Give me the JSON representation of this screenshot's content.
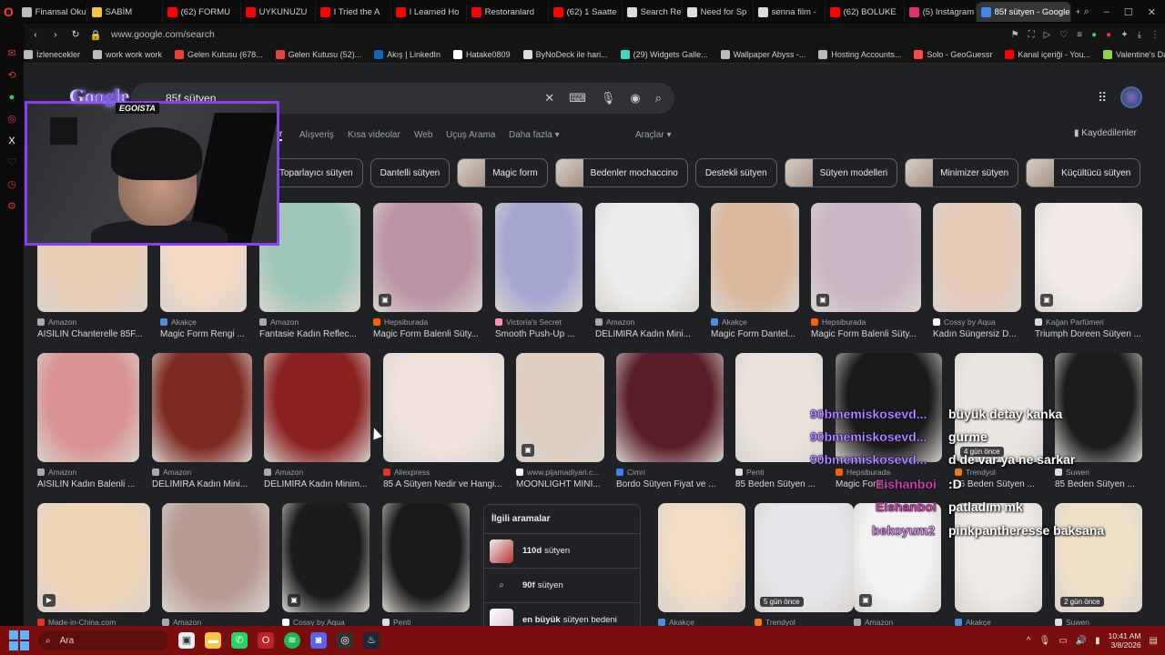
{
  "browser": {
    "tabs": [
      {
        "label": "Finansal Oku",
        "color": "#bbbbbb"
      },
      {
        "label": "SABİM",
        "color": "#f4c542"
      },
      {
        "label": "(62) FORMU",
        "color": "#ff0000"
      },
      {
        "label": "UYKUNUZU",
        "color": "#ff0000"
      },
      {
        "label": "I Tried the A",
        "color": "#ff0000"
      },
      {
        "label": "I Learned Ho",
        "color": "#ff0000"
      },
      {
        "label": "Restoranlard",
        "color": "#ff0000"
      },
      {
        "label": "(62) 1 Saatte",
        "color": "#ff0000"
      },
      {
        "label": "Search Resu",
        "color": "#dddddd"
      },
      {
        "label": "Need for Sp",
        "color": "#dddddd"
      },
      {
        "label": "senna film -",
        "color": "#dddddd"
      },
      {
        "label": "(62) BOLUKE",
        "color": "#ff0000"
      },
      {
        "label": "(5) Instagram",
        "color": "#e1306c"
      },
      {
        "label": "85f sütyen - Google'da",
        "color": "#4285f4",
        "active": true
      }
    ],
    "url": "www.google.com/search",
    "bookmarks": [
      {
        "label": "İzlenecekler",
        "color": "#bbbbbb"
      },
      {
        "label": "work work work",
        "color": "#bbbbbb"
      },
      {
        "label": "Gelen Kutusu (678...",
        "color": "#ea4335"
      },
      {
        "label": "Gelen Kutusu (52)...",
        "color": "#ea4335"
      },
      {
        "label": "Akış | LinkedIn",
        "color": "#0a66c2"
      },
      {
        "label": "Hatake0809",
        "color": "#ffffff"
      },
      {
        "label": "ByNoDeck ile hari...",
        "color": "#dddddd"
      },
      {
        "label": "(29) Widgets Galle...",
        "color": "#3fd6c4"
      },
      {
        "label": "Wallpaper Abyss -...",
        "color": "#bbbbbb"
      },
      {
        "label": "Hosting Accounts...",
        "color": "#bbbbbb"
      },
      {
        "label": "Solo - GeoGuessr",
        "color": "#ff4a4a"
      },
      {
        "label": "Kanal içeriği - You...",
        "color": "#ff0000"
      },
      {
        "label": "Valentine's Day Pr...",
        "color": "#8bd649"
      }
    ]
  },
  "google": {
    "logo": "Google",
    "query": "85f sütyen",
    "tabs": {
      "all": "r",
      "shopping": "Alışveriş",
      "short": "Kısa videolar",
      "web": "Web",
      "flights": "Uçuş Arama",
      "more": "Daha fazla ▾",
      "tools": "Araçlar ▾",
      "saved": "Kaydedilenler"
    },
    "chips": [
      {
        "label": "Toparlayıcı sütyen",
        "img": false
      },
      {
        "label": "Dantelli sütyen",
        "img": false
      },
      {
        "label": "Magic form",
        "img": true
      },
      {
        "label": "Bedenler mochaccino",
        "img": true
      },
      {
        "label": "Destekli sütyen",
        "img": false
      },
      {
        "label": "Sütyen modelleri",
        "img": true
      },
      {
        "label": "Minimizer sütyen",
        "img": true
      },
      {
        "label": "Küçültücü sütyen",
        "img": true
      }
    ],
    "row1": [
      {
        "src": "Amazon",
        "title": "AISILIN Chanterelle 85F...",
        "bg": "#e9cdb4",
        "sf": "#aaaaaa"
      },
      {
        "src": "Akakçe",
        "title": "Magic Form Rengi ...",
        "bg": "#f1d9c4",
        "sf": "#4a8fe0"
      },
      {
        "src": "Amazon",
        "title": "Fantasie Kadın Reflec...",
        "bg": "#9fc7b8",
        "sf": "#aaaaaa"
      },
      {
        "src": "Hepsiburada",
        "title": "Magic Form Balenli Süty...",
        "bg": "#b993a4",
        "sf": "#ff6000"
      },
      {
        "src": "Victoria's Secret",
        "title": "Smooth Push-Up ...",
        "bg": "#a6a7d1",
        "sf": "#ff8fb0"
      },
      {
        "src": "Amazon",
        "title": "DELIMIRA Kadın Mini...",
        "bg": "#eeeeee",
        "sf": "#aaaaaa"
      },
      {
        "src": "Akakçe",
        "title": "Magic Form Dantel...",
        "bg": "#d9b89d",
        "sf": "#4a8fe0"
      },
      {
        "src": "Hepsiburada",
        "title": "Magic Form Balenli Süty...",
        "bg": "#c9b5c4",
        "sf": "#ff6000"
      },
      {
        "src": "Cossy by Aqua",
        "title": "Kadın Süngersiz D...",
        "bg": "#e6cbb8",
        "sf": "#ffffff"
      },
      {
        "src": "Kağan Parfümeri",
        "title": "Triumph Doreen Sütyen ...",
        "bg": "#f3ecea",
        "sf": "#dddddd"
      }
    ],
    "row2": [
      {
        "src": "Amazon",
        "title": "AISILIN Kadın Balenli ...",
        "bg": "#d99391",
        "sf": "#aaaaaa"
      },
      {
        "src": "Amazon",
        "title": "DELIMIRA Kadın Mini...",
        "bg": "#7d2a22",
        "sf": "#aaaaaa"
      },
      {
        "src": "Amazon",
        "title": "DELIMIRA Kadın Minim...",
        "bg": "#8a2020",
        "sf": "#aaaaaa"
      },
      {
        "src": "Aliexpress",
        "title": "85 A Sütyen Nedir ve Hangi...",
        "bg": "#efe3dc",
        "sf": "#e43225"
      },
      {
        "src": "www.pijamadiyari.c...",
        "title": "MOONLIGHT MİNİ...",
        "bg": "#e0cdbd",
        "sf": "#ffffff"
      },
      {
        "src": "Cimri",
        "title": "Bordo Sütyen Fiyat ve ...",
        "bg": "#5b1d2a",
        "sf": "#3b82f6"
      },
      {
        "src": "Penti",
        "title": "85 Beden Sütyen ...",
        "bg": "#eae3dc",
        "sf": "#dddddd"
      },
      {
        "src": "Hepsiburada",
        "title": "Magic Form...",
        "bg": "#1a1a1a",
        "sf": "#ff6000"
      },
      {
        "src": "Trendyol",
        "title": "85 Beden Sütyen ...",
        "bg": "#ebe6e2",
        "sf": "#f27a1a"
      },
      {
        "src": "Suwen",
        "title": "85 Beden Sütyen ...",
        "bg": "#1c1c1c",
        "sf": "#dddddd"
      }
    ],
    "row3": [
      {
        "src": "Made-in-China.com",
        "bg": "#f2d6b8",
        "sf": "#e43225"
      },
      {
        "src": "Amazon",
        "bg": "#b79b93",
        "sf": "#aaaaaa"
      },
      {
        "src": "Cossy by Aqua",
        "bg": "#1b1b1b",
        "sf": "#ffffff"
      },
      {
        "src": "Penti",
        "bg": "#1a1a1a",
        "sf": "#dddddd"
      },
      {
        "src": "Akakçe",
        "bg": "#f1dcc4",
        "sf": "#4a8fe0"
      },
      {
        "src": "Trendyol",
        "bg": "#e6e6ea",
        "sf": "#f27a1a"
      },
      {
        "src": "Amazon",
        "bg": "#f2f2f2",
        "sf": "#aaaaaa"
      },
      {
        "src": "Akakçe",
        "bg": "#f0ebe6",
        "sf": "#4a8fe0"
      },
      {
        "src": "Suwen",
        "bg": "#efe0c8",
        "sf": "#dddddd"
      }
    ],
    "badges": {
      "ago4": "4 gün önce",
      "ago5": "5 gün önce",
      "ago2": "2 gün önce"
    },
    "related": {
      "heading": "İlgili aramalar",
      "items": [
        {
          "bold": "110d",
          "rest": "sütyen"
        },
        {
          "bold": "90f",
          "rest": "sütyen"
        },
        {
          "bold": "en büyük",
          "rest": "sütyen bedeni"
        }
      ]
    }
  },
  "stream": {
    "brand": "Google",
    "tag": "EGOISTA",
    "chat": [
      {
        "user": "90bmemiskosevd...",
        "msg": "büyük detay kanka"
      },
      {
        "user": "90bmemiskosevd...",
        "msg": "gurme"
      },
      {
        "user": "90bmemiskosevd...",
        "msg": "d de var ya ne sarkar"
      },
      {
        "user": "Eishanboi",
        "msg": ":D"
      },
      {
        "user": "Eishanboi",
        "msg": "patladım mk"
      },
      {
        "user": "bekoyum2",
        "msg": "pinkpantheresse baksana"
      }
    ]
  },
  "taskbar": {
    "search": "Ara",
    "time": "10:41 AM",
    "date": "3/8/2026"
  }
}
